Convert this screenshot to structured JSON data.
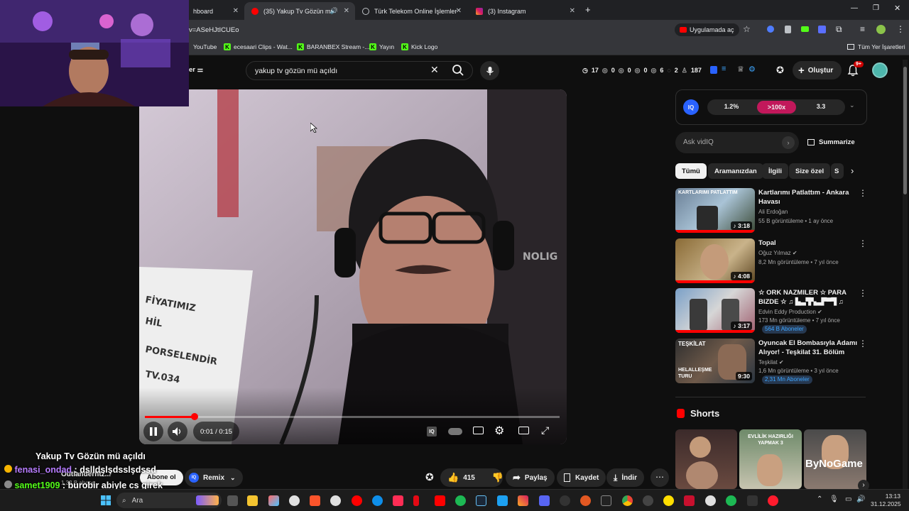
{
  "browser": {
    "tabs": [
      {
        "label": "hboard"
      },
      {
        "label": "(35) Yakup Tv Gözün mü aç"
      },
      {
        "label": "Türk Telekom Online İşlemler"
      },
      {
        "label": "(3) Instagram"
      }
    ],
    "new_tab": "+",
    "url": "v=ASeHJtICUEo",
    "open_app_label": "Uygulamada aç",
    "bookmarks": [
      "YouTube",
      "ecesaari Clips - Wat...",
      "BARANBEX Stream -...",
      "Yayın",
      "Kick Logo"
    ],
    "all_bookmarks": "Tüm Yer İşaretleri"
  },
  "youtube": {
    "search_query": "yakup tv gözün mü açıldı",
    "header_stats": [
      "17",
      "0",
      "0",
      "0",
      "6",
      "2",
      "187"
    ],
    "create_label": "Oluştur",
    "notif_count": "9+",
    "left_label": "er"
  },
  "player": {
    "time": "0:01 / 0:15",
    "progress": 0.12,
    "overlay_texts": [
      "FİYATIMIZ",
      "HİL",
      "PORSELENDİR",
      "TV.034"
    ],
    "wall_text": "NOLIG"
  },
  "vidiq": {
    "logo": "IQ",
    "score1": "1.2%",
    "score2": ">100x",
    "score3": "3.3",
    "ask_placeholder": "Ask vidIQ",
    "summarize": "Summarize"
  },
  "chips": [
    "Tümü",
    "Aramanızdan",
    "İlgili",
    "Size özel",
    "S"
  ],
  "recommendations": [
    {
      "title": "Kartlarımı Patlattım - Ankara Havası",
      "channel": "Ali Erdoğan",
      "meta": "55 B görüntüleme • 1 ay önce",
      "duration": "3:18",
      "thumb_text": "KARTLARIMI PATLATTIM",
      "subs": ""
    },
    {
      "title": "Topal",
      "channel": "Oğuz Yılmaz",
      "meta": "8,2 Mn görüntüleme • 7 yıl önce",
      "duration": "4:08",
      "thumb_text": "",
      "subs": ""
    },
    {
      "title": "☆ ORK NAZMILER ☆ PARA BIZDE ☆ ♫ ▙▃▜▚▃▛▀▜ ♫ EN...",
      "channel": "Edvin Eddy Production",
      "meta": "173 Mn görüntüleme • 7 yıl önce",
      "duration": "3:17",
      "thumb_text": "",
      "subs": "564 B Aboneler"
    },
    {
      "title": "Oyuncak El Bombasıyla Adamı Alıyor! - Teşkilat 31. Bölüm",
      "channel": "Teşkilat",
      "meta": "1,6 Mn görüntüleme • 3 yıl önce",
      "duration": "9:30",
      "thumb_text": "TEŞKİLAT",
      "thumb_text2": "HELALLEŞME TURU",
      "subs": "2,31 Mn Aboneler"
    }
  ],
  "shorts": {
    "heading": "Shorts",
    "items": [
      {
        "text": ""
      },
      {
        "text": "EVLİLİK HAZIRLIĞI YAPMAK 3"
      },
      {
        "text": "ByNoGame"
      }
    ]
  },
  "below_video": {
    "video_title": "Yakup Tv Gözün mü açıldı",
    "channel_partial": "Outlanderhtz...",
    "subs_partial": "1,33 B abone",
    "subscribe": "Abone ol",
    "remix": "Remix",
    "likes": "415",
    "share": "Paylaş",
    "save": "Kaydet",
    "download": "İndir"
  },
  "chat": [
    {
      "user": "fenasi_ondad",
      "text": "dslldslşdsslşdssd",
      "color": "#b77cff"
    },
    {
      "user": "samet1909",
      "text": "burobir abiyle cs girek",
      "color": "#53fc18"
    },
    {
      "user": "fenasi_ondad",
      "text": "",
      "color": "#b77cff"
    }
  ],
  "taskbar": {
    "search": "Ara",
    "time": "13:13",
    "date": "31.12.2025"
  },
  "colors": {
    "yt_red": "#ff0000",
    "vidiq_pink": "#c2185b",
    "kick_green": "#53fc18",
    "link_blue": "#3ea6ff"
  }
}
